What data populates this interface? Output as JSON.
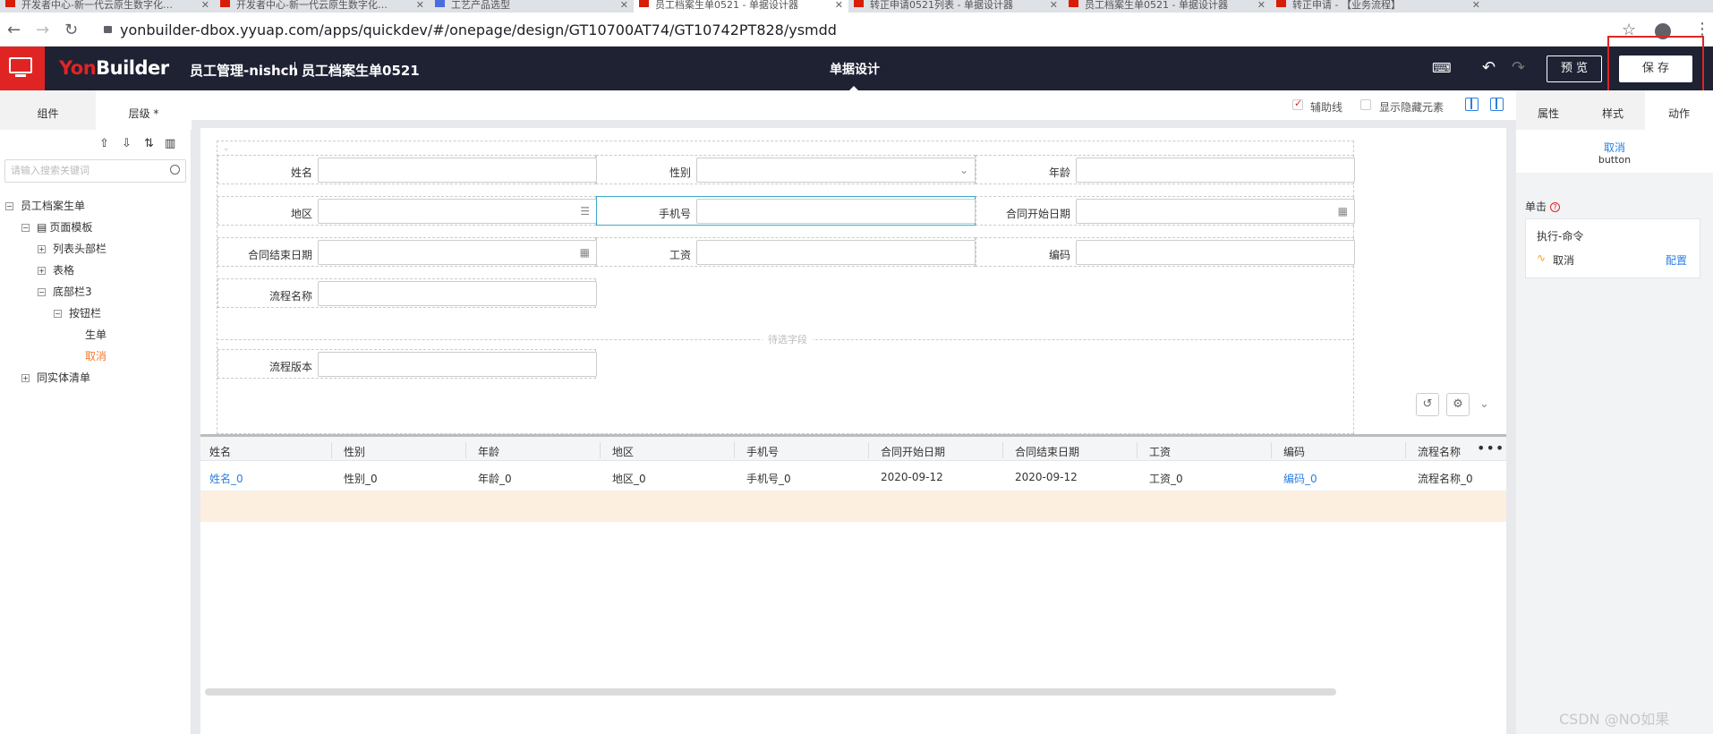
{
  "browser": {
    "tabs": [
      "开发者中心-新一代云原生数字化…",
      "开发者中心-新一代云原生数字化…",
      "工艺产品选型",
      "员工档案生单0521 - 单据设计器",
      "转正申请0521列表 - 单据设计器",
      "员工档案生单0521 - 单据设计器",
      "转正申请 - 【业务流程】"
    ],
    "url": "yonbuilder-dbox.yyuap.com/apps/quickdev/#/onepage/design/GT10700AT74/GT10742PT828/ysmdd"
  },
  "header": {
    "brand_prefix": "Yon",
    "brand_suffix": "Builder",
    "crumb1": "员工管理-nishch",
    "crumb2": "员工档案生单0521",
    "center_title": "单据设计",
    "preview_label": "预 览",
    "save_label": "保 存"
  },
  "left": {
    "tabs": [
      "组件",
      "层级 *"
    ],
    "search_placeholder": "请输入搜索关键词",
    "tree": [
      {
        "label": "员工档案生单",
        "toggle": "−"
      },
      {
        "label": "页面模板",
        "toggle": "−"
      },
      {
        "label": "列表头部栏",
        "toggle": "+"
      },
      {
        "label": "表格",
        "toggle": "+"
      },
      {
        "label": "底部栏3",
        "toggle": "−"
      },
      {
        "label": "按钮栏",
        "toggle": "−"
      },
      {
        "label": "生单",
        "toggle": ""
      },
      {
        "label": "取消",
        "toggle": ""
      },
      {
        "label": "同实体清单",
        "toggle": "+"
      }
    ]
  },
  "canvas": {
    "opt_assist": "辅助线",
    "opt_hidden": "显示隐藏元素",
    "pending_label": "待选字段",
    "fields": {
      "name": "姓名",
      "gender": "性别",
      "age": "年龄",
      "region": "地区",
      "phone": "手机号",
      "contract_start": "合同开始日期",
      "contract_end": "合同结束日期",
      "salary": "工资",
      "code": "编码",
      "flow_name": "流程名称",
      "flow_version": "流程版本"
    },
    "table": {
      "headers": [
        "姓名",
        "性别",
        "年龄",
        "地区",
        "手机号",
        "合同开始日期",
        "合同结束日期",
        "工资",
        "编码",
        "流程名称"
      ],
      "row": [
        "姓名_0",
        "性别_0",
        "年龄_0",
        "地区_0",
        "手机号_0",
        "2020-09-12",
        "2020-09-12",
        "工资_0",
        "编码_0",
        "流程名称_0"
      ]
    }
  },
  "right": {
    "tabs": [
      "属性",
      "样式",
      "动作"
    ],
    "selected_name": "取消",
    "selected_type": "button",
    "event_label": "单击",
    "event_cmd": "执行-命令",
    "event_action": "取消",
    "event_config": "配置"
  },
  "watermark": "CSDN @NO如果",
  "colors": {
    "brand_red": "#e02424",
    "header_bg": "#1e2233",
    "link_blue": "#2d7fe0",
    "focus_teal": "#3ca8c4"
  }
}
